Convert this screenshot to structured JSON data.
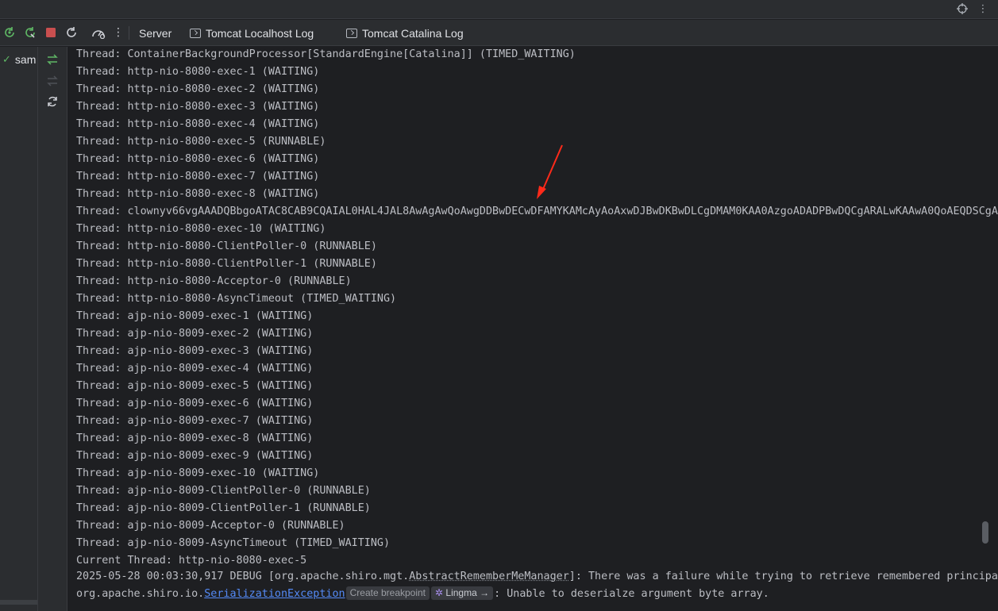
{
  "topbar": {
    "icons": [
      "crosshair-icon",
      "more-vertical-icon"
    ],
    "more_glyph": "⋮"
  },
  "toolbar": {
    "buttons": [
      {
        "name": "update-application-icon",
        "glyph": "↻",
        "color": "#5fb865"
      },
      {
        "name": "redeploy-icon",
        "glyph": "↻",
        "color": "#5fb865"
      },
      {
        "name": "stop-icon",
        "glyph": "■",
        "color": "#e05555"
      },
      {
        "name": "restart-icon",
        "glyph": "↻",
        "color": "#ced0d6"
      },
      {
        "name": "profiler-icon",
        "glyph": "◔",
        "color": "#ced0d6"
      },
      {
        "name": "more-options-icon",
        "glyph": "⋮",
        "color": "#ced0d6"
      }
    ],
    "tabs": [
      "Server",
      "Tomcat Localhost Log",
      "Tomcat Catalina Log"
    ]
  },
  "tree": {
    "item_label": "sam",
    "check_glyph": "✓"
  },
  "actions": [
    {
      "name": "deploy-all-icon",
      "glyph": "⇆",
      "color": "#5fb865"
    },
    {
      "name": "undeploy-icon",
      "glyph": "⇆",
      "color": "#5a5d63"
    },
    {
      "name": "refresh-icon",
      "glyph": "⟳",
      "color": "#ced0d6"
    }
  ],
  "console": {
    "lines": [
      "Thread: ContainerBackgroundProcessor[StandardEngine[Catalina]] (TIMED_WAITING)",
      "Thread: http-nio-8080-exec-1 (WAITING)",
      "Thread: http-nio-8080-exec-2 (WAITING)",
      "Thread: http-nio-8080-exec-3 (WAITING)",
      "Thread: http-nio-8080-exec-4 (WAITING)",
      "Thread: http-nio-8080-exec-5 (RUNNABLE)",
      "Thread: http-nio-8080-exec-6 (WAITING)",
      "Thread: http-nio-8080-exec-7 (WAITING)",
      "Thread: http-nio-8080-exec-8 (WAITING)",
      "Thread: clownyv66vgAAADQBbgoATAC8CAB9CQAIAL0HAL4JAL8AwAgAwQoAwgDDBwDECwDFAMYKAMcAyAoAxwDJBwDKBwDLCgDMAM0KAA0AzgoADADPBwDQCgARALwKAAwA0QoAEQDSCgA",
      "Thread: http-nio-8080-exec-10 (WAITING)",
      "Thread: http-nio-8080-ClientPoller-0 (RUNNABLE)",
      "Thread: http-nio-8080-ClientPoller-1 (RUNNABLE)",
      "Thread: http-nio-8080-Acceptor-0 (RUNNABLE)",
      "Thread: http-nio-8080-AsyncTimeout (TIMED_WAITING)",
      "Thread: ajp-nio-8009-exec-1 (WAITING)",
      "Thread: ajp-nio-8009-exec-2 (WAITING)",
      "Thread: ajp-nio-8009-exec-3 (WAITING)",
      "Thread: ajp-nio-8009-exec-4 (WAITING)",
      "Thread: ajp-nio-8009-exec-5 (WAITING)",
      "Thread: ajp-nio-8009-exec-6 (WAITING)",
      "Thread: ajp-nio-8009-exec-7 (WAITING)",
      "Thread: ajp-nio-8009-exec-8 (WAITING)",
      "Thread: ajp-nio-8009-exec-9 (WAITING)",
      "Thread: ajp-nio-8009-exec-10 (WAITING)",
      "Thread: ajp-nio-8009-ClientPoller-0 (RUNNABLE)",
      "Thread: ajp-nio-8009-ClientPoller-1 (RUNNABLE)",
      "Thread: ajp-nio-8009-Acceptor-0 (RUNNABLE)",
      "Thread: ajp-nio-8009-AsyncTimeout (TIMED_WAITING)",
      "Current Thread: http-nio-8080-exec-5"
    ],
    "debug_line": {
      "prefix": "2025-05-28 00:03:30,917 DEBUG [org.apache.shiro.mgt.",
      "class_name": "AbstractRememberMeManager",
      "suffix": "]: There was a failure while trying to retrieve remembered principa"
    },
    "exception_line": {
      "prefix": "org.apache.shiro.io.",
      "exception_name": "SerializationException",
      "breakpoint_hint": "Create breakpoint",
      "lingma_glyph": "✲",
      "lingma_label": "Lingma →",
      "suffix": ": Unable to deserialze argument byte array."
    }
  },
  "annotation": {
    "arrow_color": "#ff2a1a"
  }
}
